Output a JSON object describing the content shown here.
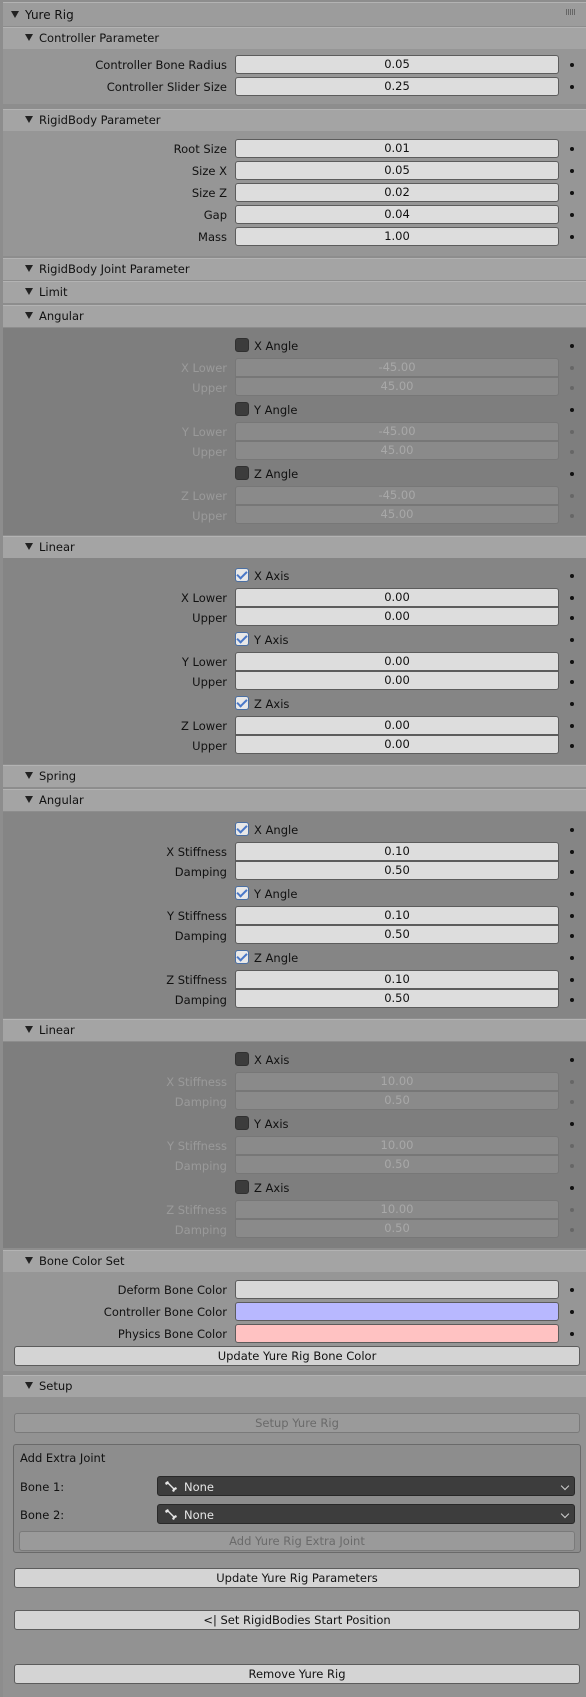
{
  "panel_title": "Yure Rig",
  "sections": {
    "controller": "Controller Parameter",
    "rigidbody": "RigidBody Parameter",
    "joint": "RigidBody Joint Parameter",
    "limit": "Limit",
    "limit_angular": "Angular",
    "limit_linear": "Linear",
    "spring": "Spring",
    "spring_angular": "Angular",
    "spring_linear": "Linear",
    "bone_color": "Bone Color Set",
    "setup": "Setup"
  },
  "controller": {
    "bone_radius_label": "Controller Bone Radius",
    "bone_radius_value": "0.05",
    "slider_size_label": "Controller Slider Size",
    "slider_size_value": "0.25"
  },
  "rigidbody": {
    "root_size_label": "Root Size",
    "root_size_value": "0.01",
    "size_x_label": "Size X",
    "size_x_value": "0.05",
    "size_z_label": "Size Z",
    "size_z_value": "0.02",
    "gap_label": "Gap",
    "gap_value": "0.04",
    "mass_label": "Mass",
    "mass_value": "1.00"
  },
  "limit_angular": {
    "x_check": "X Angle",
    "x_lower_label": "X Lower",
    "x_lower": "-45.00",
    "x_upper_label": "Upper",
    "x_upper": "45.00",
    "y_check": "Y Angle",
    "y_lower_label": "Y Lower",
    "y_lower": "-45.00",
    "y_upper_label": "Upper",
    "y_upper": "45.00",
    "z_check": "Z Angle",
    "z_lower_label": "Z Lower",
    "z_lower": "-45.00",
    "z_upper_label": "Upper",
    "z_upper": "45.00"
  },
  "limit_linear": {
    "x_check": "X Axis",
    "x_lower_label": "X Lower",
    "x_lower": "0.00",
    "x_upper_label": "Upper",
    "x_upper": "0.00",
    "y_check": "Y Axis",
    "y_lower_label": "Y Lower",
    "y_lower": "0.00",
    "y_upper_label": "Upper",
    "y_upper": "0.00",
    "z_check": "Z Axis",
    "z_lower_label": "Z Lower",
    "z_lower": "0.00",
    "z_upper_label": "Upper",
    "z_upper": "0.00"
  },
  "spring_angular": {
    "x_check": "X Angle",
    "x_stiff_label": "X Stiffness",
    "x_stiff": "0.10",
    "x_damp_label": "Damping",
    "x_damp": "0.50",
    "y_check": "Y Angle",
    "y_stiff_label": "Y Stiffness",
    "y_stiff": "0.10",
    "y_damp_label": "Damping",
    "y_damp": "0.50",
    "z_check": "Z Angle",
    "z_stiff_label": "Z Stiffness",
    "z_stiff": "0.10",
    "z_damp_label": "Damping",
    "z_damp": "0.50"
  },
  "spring_linear": {
    "x_check": "X Axis",
    "x_stiff_label": "X Stiffness",
    "x_stiff": "10.00",
    "x_damp_label": "Damping",
    "x_damp": "0.50",
    "y_check": "Y Axis",
    "y_stiff_label": "Y Stiffness",
    "y_stiff": "10.00",
    "y_damp_label": "Damping",
    "y_damp": "0.50",
    "z_check": "Z Axis",
    "z_stiff_label": "Z Stiffness",
    "z_stiff": "10.00",
    "z_damp_label": "Damping",
    "z_damp": "0.50"
  },
  "bone_color": {
    "deform_label": "Deform Bone Color",
    "deform_color": "#d8d8d8",
    "controller_label": "Controller Bone Color",
    "controller_color": "#b8b8ff",
    "physics_label": "Physics Bone Color",
    "physics_color": "#ffc2c2",
    "update_button": "Update Yure Rig Bone Color"
  },
  "setup": {
    "setup_button": "Setup Yure Rig",
    "extra_joint_title": "Add Extra Joint",
    "bone1_label": "Bone 1:",
    "bone1_value": "None",
    "bone2_label": "Bone 2:",
    "bone2_value": "None",
    "add_extra_button": "Add Yure Rig Extra Joint",
    "update_params_button": "Update Yure Rig Parameters",
    "set_start_button": "<|  Set RigidBodies Start Position",
    "remove_button": "Remove Yure Rig"
  }
}
